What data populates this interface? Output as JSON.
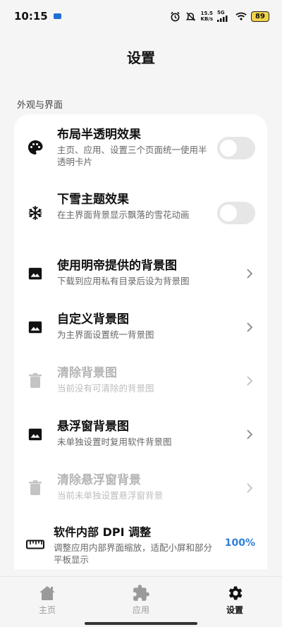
{
  "status_bar": {
    "time": "10:15",
    "net_speed_value": "15.5",
    "net_speed_unit": "KB/s",
    "network_type": "5G",
    "battery": "89"
  },
  "header": {
    "title": "设置"
  },
  "section": {
    "title": "外观与界面"
  },
  "settings": [
    {
      "title": "布局半透明效果",
      "subtitle": "主页、应用、设置三个页面统一使用半透明卡片",
      "icon": "palette-icon",
      "control": "toggle",
      "toggle_on": false,
      "enabled": true
    },
    {
      "title": "下雪主题效果",
      "subtitle": "在主界面背景显示飘落的雪花动画",
      "icon": "snowflake-icon",
      "control": "toggle",
      "toggle_on": false,
      "enabled": true
    },
    {
      "title": "使用明帝提供的背景图",
      "subtitle": "下载到应用私有目录后设为背景图",
      "icon": "image-icon",
      "control": "chevron",
      "enabled": true
    },
    {
      "title": "自定义背景图",
      "subtitle": "为主界面设置统一背景图",
      "icon": "image-icon",
      "control": "chevron",
      "enabled": true
    },
    {
      "title": "清除背景图",
      "subtitle": "当前没有可清除的背景图",
      "icon": "trash-icon",
      "control": "chevron",
      "enabled": false
    },
    {
      "title": "悬浮窗背景图",
      "subtitle": "未单独设置时复用软件背景图",
      "icon": "image-icon",
      "control": "chevron",
      "enabled": true
    },
    {
      "title": "清除悬浮窗背景",
      "subtitle": "当前未单独设置悬浮窗背景",
      "icon": "trash-icon",
      "control": "chevron",
      "enabled": false
    },
    {
      "title": "软件内部 DPI 调整",
      "subtitle": "调整应用内部界面缩放，适配小屏和部分平板显示",
      "icon": "ruler-icon",
      "control": "value",
      "value": "100%",
      "enabled": true
    }
  ],
  "bottom_nav": [
    {
      "label": "主页",
      "icon": "home-icon",
      "active": false
    },
    {
      "label": "应用",
      "icon": "puzzle-icon",
      "active": false
    },
    {
      "label": "设置",
      "icon": "gear-icon",
      "active": true
    }
  ],
  "colors": {
    "accent": "#2f7fd8",
    "background": "#f5f5f5",
    "card": "#ffffff",
    "battery": "#f0d34a"
  }
}
